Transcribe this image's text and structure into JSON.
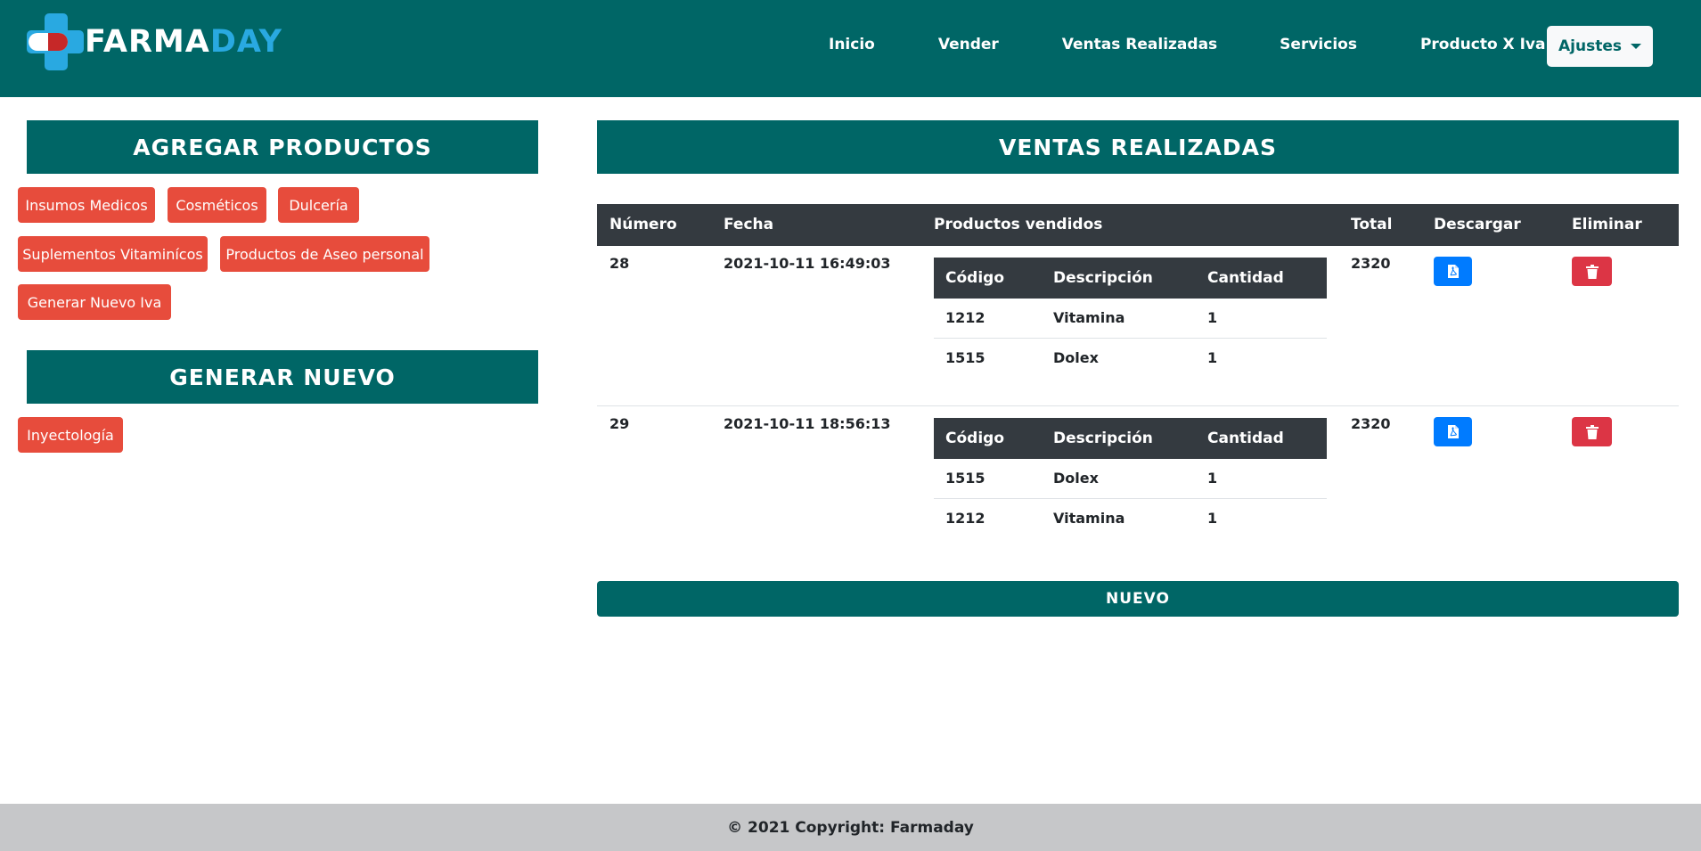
{
  "navbar": {
    "brand_part1": "FARMA",
    "brand_part2": "DAY",
    "links": [
      "Inicio",
      "Vender",
      "Ventas Realizadas",
      "Servicios",
      "Producto X Iva"
    ],
    "settings_label": "Ajustes",
    "colors": {
      "background": "#006666",
      "accent": "#29a9e1"
    }
  },
  "left": {
    "add_title": "AGREGAR PRODUCTOS",
    "add_buttons": [
      "Insumos Medicos",
      "Cosméticos",
      "Dulcería",
      "Suplementos Vitaminícos",
      "Productos de Aseo personal",
      "Generar Nuevo Iva"
    ],
    "generate_title": "GENERAR NUEVO",
    "generate_buttons": [
      "Inyectología"
    ]
  },
  "main": {
    "title": "VENTAS REALIZADAS",
    "columns": [
      "Número",
      "Fecha",
      "Productos vendidos",
      "Total",
      "Descargar",
      "Eliminar"
    ],
    "inner_columns": [
      "Código",
      "Descripción",
      "Cantidad"
    ],
    "rows": [
      {
        "numero": "28",
        "fecha": "2021-10-11 16:49:03",
        "productos": [
          {
            "codigo": "1212",
            "descripcion": "Vitamina",
            "cantidad": "1"
          },
          {
            "codigo": "1515",
            "descripcion": "Dolex",
            "cantidad": "1"
          }
        ],
        "total": "2320",
        "download_icon": "file-pdf-icon",
        "delete_icon": "trash-icon"
      },
      {
        "numero": "29",
        "fecha": "2021-10-11 18:56:13",
        "productos": [
          {
            "codigo": "1515",
            "descripcion": "Dolex",
            "cantidad": "1"
          },
          {
            "codigo": "1212",
            "descripcion": "Vitamina",
            "cantidad": "1"
          }
        ],
        "total": "2320",
        "download_icon": "file-pdf-icon",
        "delete_icon": "trash-icon"
      }
    ],
    "new_button": "NUEVO"
  },
  "footer": {
    "text": "© 2021 Copyright: Farmaday"
  }
}
